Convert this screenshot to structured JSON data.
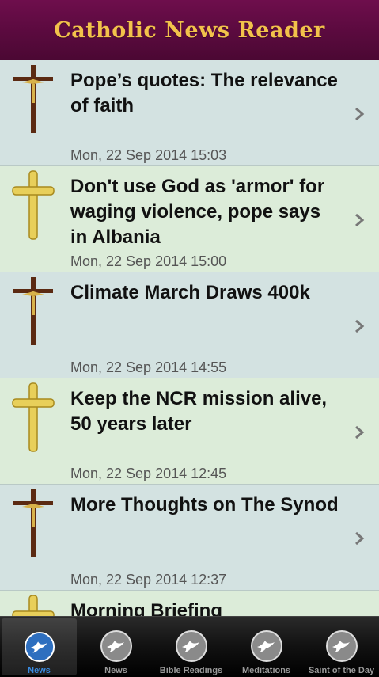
{
  "header": {
    "title": "Catholic News Reader"
  },
  "articles": [
    {
      "title": "Pope’s quotes: The relevance of faith",
      "date": "Mon, 22 Sep 2014 15:03",
      "icon": "crucifix-icon"
    },
    {
      "title": "Don't use God as 'armor' for waging violence, pope says in Albania",
      "date": "Mon, 22 Sep 2014 15:00",
      "icon": "gold-cross-icon"
    },
    {
      "title": "Climate March Draws 400k",
      "date": "Mon, 22 Sep 2014 14:55",
      "icon": "crucifix-icon"
    },
    {
      "title": "Keep the NCR mission alive, 50 years later",
      "date": "Mon, 22 Sep 2014 12:45",
      "icon": "gold-cross-icon"
    },
    {
      "title": "More Thoughts on The Synod",
      "date": "Mon, 22 Sep 2014 12:37",
      "icon": "crucifix-icon"
    },
    {
      "title": "Morning Briefing",
      "date": "",
      "icon": "gold-cross-icon"
    }
  ],
  "tabs": [
    {
      "label": "News",
      "active": true
    },
    {
      "label": "News",
      "active": false
    },
    {
      "label": "Bible Readings",
      "active": false
    },
    {
      "label": "Meditations",
      "active": false
    },
    {
      "label": "Saint of the Day",
      "active": false
    }
  ],
  "colors": {
    "header": "#5a0a3e",
    "title_gold": "#f2c24b",
    "row_a": "#d3e2e1",
    "row_b": "#dcecd9",
    "tab_active": "#3a8be0"
  }
}
